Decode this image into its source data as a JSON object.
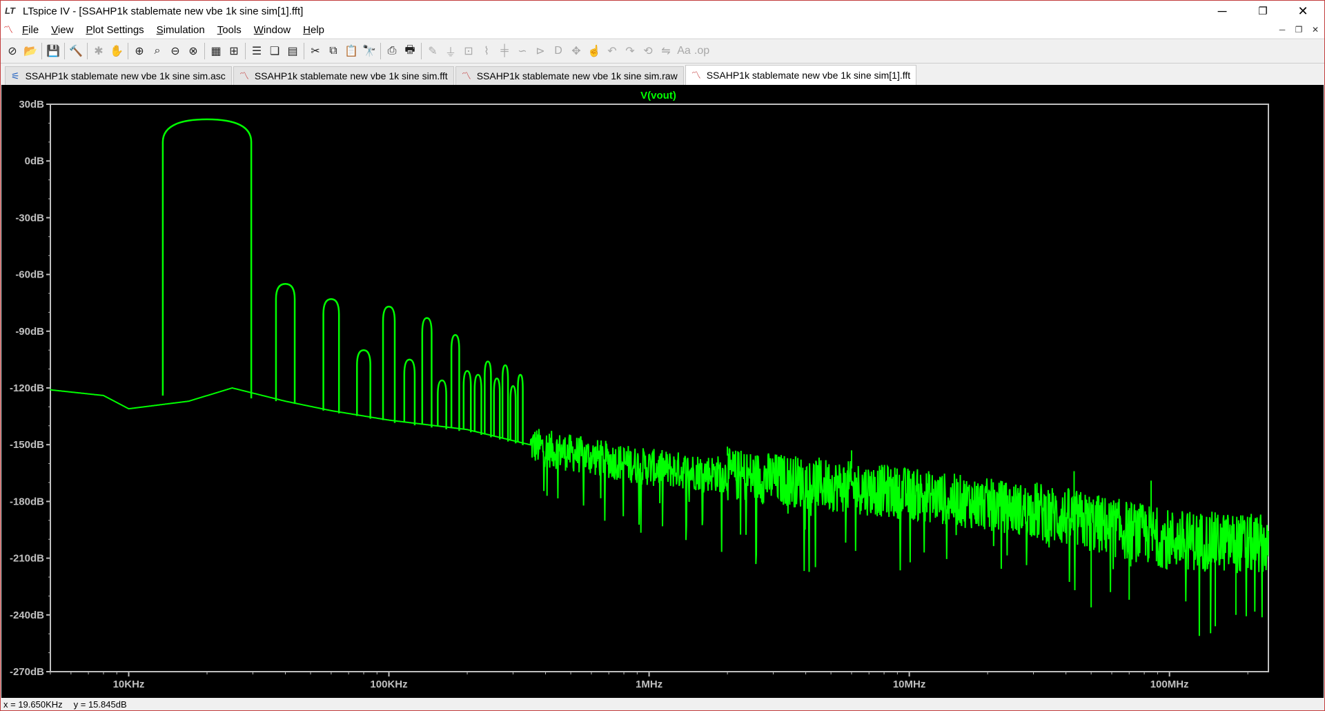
{
  "window": {
    "title": "LTspice IV - [SSAHP1k stablemate new vbe 1k sine sim[1].fft]",
    "app_icon_text": "LT",
    "controls": {
      "minimize": "─",
      "restore": "❐",
      "close": "✕"
    }
  },
  "menubar": {
    "items": [
      {
        "pre": "",
        "key": "F",
        "post": "ile"
      },
      {
        "pre": "",
        "key": "V",
        "post": "iew"
      },
      {
        "pre": "",
        "key": "P",
        "post": "lot Settings"
      },
      {
        "pre": "",
        "key": "S",
        "post": "imulation"
      },
      {
        "pre": "",
        "key": "T",
        "post": "ools"
      },
      {
        "pre": "",
        "key": "W",
        "post": "indow"
      },
      {
        "pre": "",
        "key": "H",
        "post": "elp"
      }
    ],
    "mdi_controls": {
      "minimize": "─",
      "restore": "❐",
      "close": "✕"
    }
  },
  "toolbar": {
    "groups": [
      [
        {
          "icon": "new-schematic-icon",
          "glyph": "⊘",
          "enabled": true
        },
        {
          "icon": "open-icon",
          "glyph": "📂",
          "enabled": true
        }
      ],
      [
        {
          "icon": "save-icon",
          "glyph": "💾",
          "enabled": true
        }
      ],
      [
        {
          "icon": "control-panel-icon",
          "glyph": "🔨",
          "enabled": true
        }
      ],
      [
        {
          "icon": "run-icon",
          "glyph": "✱",
          "enabled": false
        },
        {
          "icon": "pan-icon",
          "glyph": "✋",
          "enabled": false
        }
      ],
      [
        {
          "icon": "zoom-in-icon",
          "glyph": "⊕",
          "enabled": true
        },
        {
          "icon": "zoom-area-icon",
          "glyph": "⌕",
          "enabled": true
        },
        {
          "icon": "zoom-out-icon",
          "glyph": "⊖",
          "enabled": true
        },
        {
          "icon": "zoom-cancel-icon",
          "glyph": "⊗",
          "enabled": true
        }
      ],
      [
        {
          "icon": "autorange-icon",
          "glyph": "▦",
          "enabled": true
        },
        {
          "icon": "mark-icon",
          "glyph": "⊞",
          "enabled": true
        }
      ],
      [
        {
          "icon": "tile-horizontal-icon",
          "glyph": "☰",
          "enabled": true
        },
        {
          "icon": "cascade-icon",
          "glyph": "❏",
          "enabled": true
        },
        {
          "icon": "tile-vertical-icon",
          "glyph": "▤",
          "enabled": true
        }
      ],
      [
        {
          "icon": "cut-icon",
          "glyph": "✂",
          "enabled": true
        },
        {
          "icon": "copy-icon",
          "glyph": "⧉",
          "enabled": true
        },
        {
          "icon": "paste-icon",
          "glyph": "📋",
          "enabled": true
        },
        {
          "icon": "find-icon",
          "glyph": "🔭",
          "enabled": true
        }
      ],
      [
        {
          "icon": "print-preview-icon",
          "glyph": "⎙",
          "enabled": true
        },
        {
          "icon": "print-icon",
          "glyph": "🖶",
          "enabled": true
        }
      ],
      [
        {
          "icon": "wire-icon",
          "glyph": "✎",
          "enabled": false
        },
        {
          "icon": "ground-icon",
          "glyph": "⏚",
          "enabled": false
        },
        {
          "icon": "label-net-icon",
          "glyph": "⊡",
          "enabled": false
        },
        {
          "icon": "resistor-icon",
          "glyph": "⌇",
          "enabled": false
        },
        {
          "icon": "capacitor-icon",
          "glyph": "╪",
          "enabled": false
        },
        {
          "icon": "inductor-icon",
          "glyph": "∽",
          "enabled": false
        },
        {
          "icon": "diode-icon",
          "glyph": "⊳",
          "enabled": false
        },
        {
          "icon": "component-icon",
          "glyph": "D",
          "enabled": false
        },
        {
          "icon": "move-icon",
          "glyph": "✥",
          "enabled": false
        },
        {
          "icon": "drag-icon",
          "glyph": "☝",
          "enabled": false
        },
        {
          "icon": "undo-icon",
          "glyph": "↶",
          "enabled": false
        },
        {
          "icon": "redo-icon",
          "glyph": "↷",
          "enabled": false
        },
        {
          "icon": "rotate-icon",
          "glyph": "⟲",
          "enabled": false
        },
        {
          "icon": "mirror-icon",
          "glyph": "⇋",
          "enabled": false
        },
        {
          "icon": "text-icon",
          "glyph": "Aa",
          "enabled": false
        },
        {
          "icon": "spice-directive-icon",
          "glyph": ".op",
          "enabled": false
        }
      ]
    ]
  },
  "tabs": [
    {
      "label": "SSAHP1k stablemate new vbe 1k sine sim.asc",
      "icon": "schematic-icon",
      "glyph": "⚟",
      "active": false
    },
    {
      "label": "SSAHP1k stablemate new vbe 1k sine sim.fft",
      "icon": "waveform-icon",
      "glyph": "〽",
      "active": false
    },
    {
      "label": "SSAHP1k stablemate new vbe 1k sine sim.raw",
      "icon": "waveform-icon",
      "glyph": "〽",
      "active": false
    },
    {
      "label": "SSAHP1k stablemate new vbe 1k sine sim[1].fft",
      "icon": "waveform-icon",
      "glyph": "〽",
      "active": true
    }
  ],
  "chart_data": {
    "type": "line",
    "title": "V(vout)",
    "xscale": "log",
    "xlim": [
      5000,
      240000000
    ],
    "ylim": [
      -270,
      30
    ],
    "x_ticks": [
      "10KHz",
      "100KHz",
      "1MHz",
      "10MHz",
      "100MHz"
    ],
    "y_ticks": [
      "30dB",
      "0dB",
      "-30dB",
      "-60dB",
      "-90dB",
      "-120dB",
      "-150dB",
      "-180dB",
      "-210dB",
      "-240dB",
      "-270dB"
    ],
    "grid": false,
    "colors": {
      "background": "#000000",
      "trace": "#00ff00",
      "axis": "#c0c0c0",
      "labels": "#c0c0c0",
      "title": "#00ff00"
    },
    "series": [
      {
        "name": "V(vout)",
        "fundamental": {
          "x": 20000,
          "y": 22
        },
        "peaks": [
          {
            "x": 20000,
            "y": 22
          },
          {
            "x": 40000,
            "y": -65
          },
          {
            "x": 60000,
            "y": -73
          },
          {
            "x": 80000,
            "y": -100
          },
          {
            "x": 100000,
            "y": -77
          },
          {
            "x": 120000,
            "y": -105
          },
          {
            "x": 140000,
            "y": -83
          },
          {
            "x": 160000,
            "y": -116
          },
          {
            "x": 180000,
            "y": -92
          },
          {
            "x": 200000,
            "y": -111
          },
          {
            "x": 220000,
            "y": -113
          },
          {
            "x": 240000,
            "y": -106
          },
          {
            "x": 260000,
            "y": -115
          },
          {
            "x": 280000,
            "y": -108
          },
          {
            "x": 300000,
            "y": -119
          },
          {
            "x": 320000,
            "y": -113
          }
        ],
        "floor": [
          {
            "x": 5000,
            "y": -121
          },
          {
            "x": 8000,
            "y": -124
          },
          {
            "x": 10000,
            "y": -131
          },
          {
            "x": 17000,
            "y": -127
          },
          {
            "x": 25000,
            "y": -120
          },
          {
            "x": 40000,
            "y": -127
          },
          {
            "x": 60000,
            "y": -132
          },
          {
            "x": 100000,
            "y": -137
          },
          {
            "x": 200000,
            "y": -142
          },
          {
            "x": 400000,
            "y": -152
          },
          {
            "x": 1000000,
            "y": -162
          },
          {
            "x": 3000000,
            "y": -168
          },
          {
            "x": 10000000,
            "y": -176
          },
          {
            "x": 30000000,
            "y": -185
          },
          {
            "x": 45000000,
            "y": -190
          },
          {
            "x": 100000000,
            "y": -200
          },
          {
            "x": 240000000,
            "y": -203
          }
        ],
        "spur_peaks": [
          {
            "x": 43000000,
            "y": -164
          },
          {
            "x": 85000000,
            "y": -169
          },
          {
            "x": 2000000,
            "y": -151
          },
          {
            "x": 6000000,
            "y": -153
          }
        ],
        "notches": [
          {
            "x": 42000000,
            "y": -190
          },
          {
            "x": 85000000,
            "y": -193
          },
          {
            "x": 130000000,
            "y": -195
          },
          {
            "x": 170000000,
            "y": -198
          }
        ],
        "min_dips": [
          {
            "x": 50000000,
            "y": -236
          },
          {
            "x": 70000000,
            "y": -232
          },
          {
            "x": 150000000,
            "y": -246
          },
          {
            "x": 180000000,
            "y": -240
          }
        ]
      }
    ]
  },
  "statusbar": {
    "x_readout": "x = 19.650KHz",
    "y_readout": "y = 15.845dB"
  }
}
